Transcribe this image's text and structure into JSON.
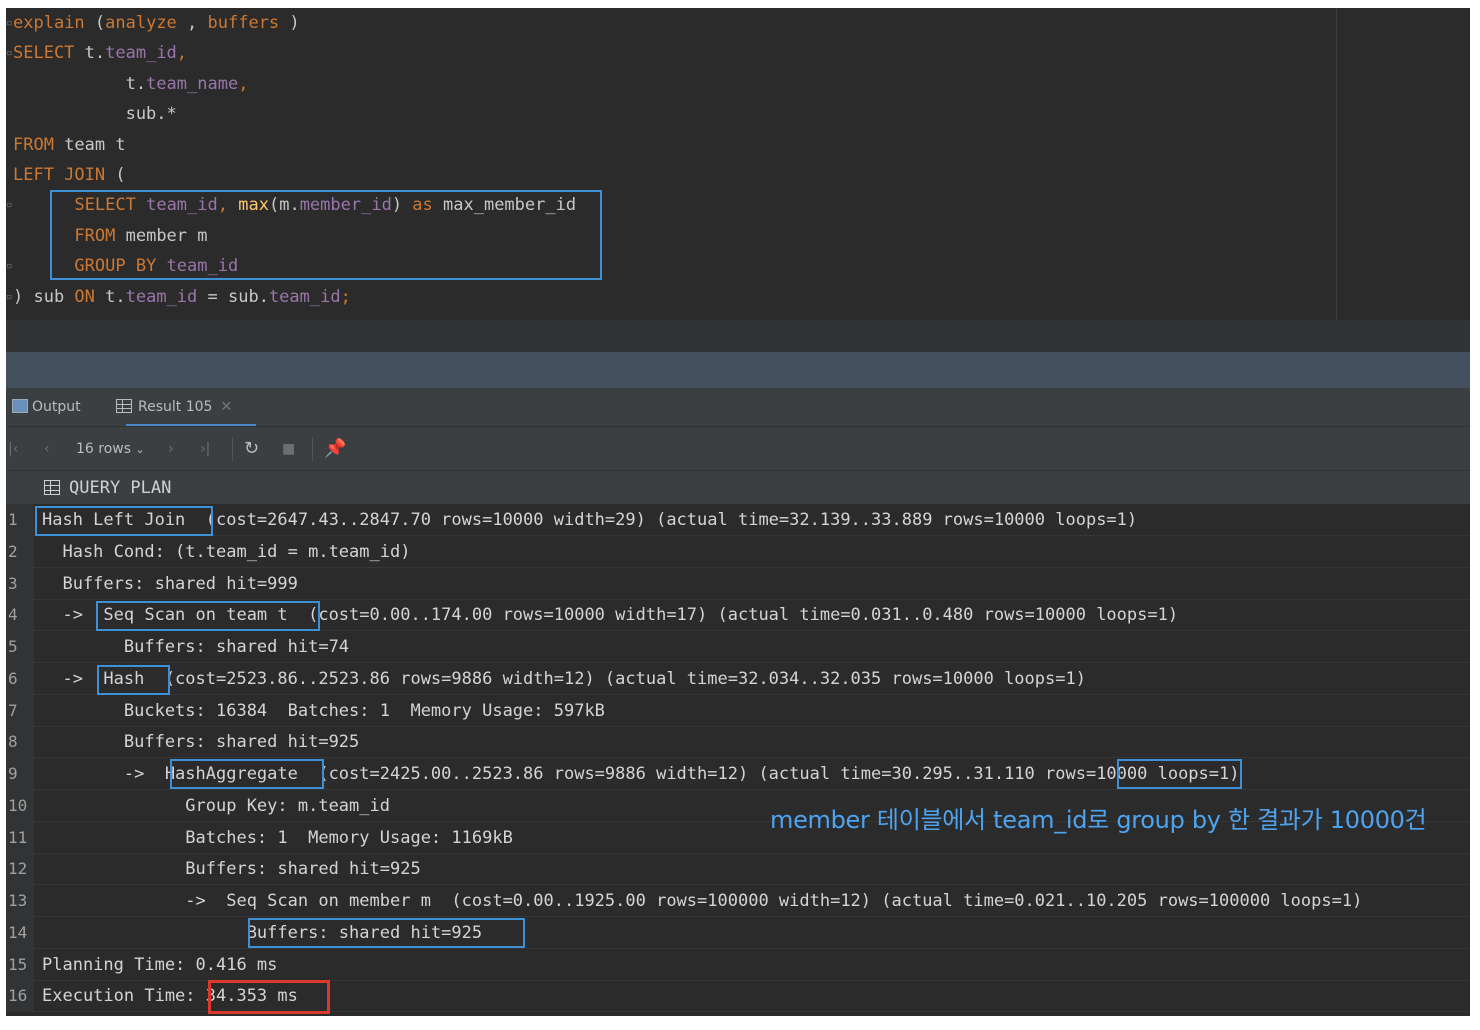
{
  "editor": {
    "lines": [
      {
        "parts": [
          [
            "kw",
            "explain"
          ],
          [
            "pl",
            " ("
          ],
          [
            "kw",
            "analyze"
          ],
          [
            "pl",
            " , "
          ],
          [
            "kw",
            "buffers"
          ],
          [
            "pl",
            " )"
          ]
        ]
      },
      {
        "parts": [
          [
            "kw",
            "SELECT"
          ],
          [
            "pl",
            " t."
          ],
          [
            "id",
            "team_id"
          ],
          [
            "kw",
            ","
          ]
        ]
      },
      {
        "parts": [
          [
            "pl",
            "           t."
          ],
          [
            "id",
            "team_name"
          ],
          [
            "kw",
            ","
          ]
        ]
      },
      {
        "parts": [
          [
            "pl",
            "           sub.*"
          ]
        ]
      },
      {
        "parts": [
          [
            "kw",
            "FROM"
          ],
          [
            "pl",
            " team t"
          ]
        ]
      },
      {
        "parts": [
          [
            "kw",
            "LEFT JOIN"
          ],
          [
            "pl",
            " ("
          ]
        ]
      },
      {
        "parts": [
          [
            "pl",
            "      "
          ],
          [
            "kw",
            "SELECT"
          ],
          [
            "pl",
            " "
          ],
          [
            "id",
            "team_id"
          ],
          [
            "kw",
            ","
          ],
          [
            "pl",
            " "
          ],
          [
            "fn",
            "max"
          ],
          [
            "pl",
            "(m."
          ],
          [
            "id",
            "member_id"
          ],
          [
            "pl",
            ") "
          ],
          [
            "kw",
            "as"
          ],
          [
            "pl",
            " max_member_id"
          ]
        ]
      },
      {
        "parts": [
          [
            "pl",
            "      "
          ],
          [
            "kw",
            "FROM"
          ],
          [
            "pl",
            " member m"
          ]
        ]
      },
      {
        "parts": [
          [
            "pl",
            "      "
          ],
          [
            "kw",
            "GROUP BY"
          ],
          [
            "pl",
            " "
          ],
          [
            "id",
            "team_id"
          ]
        ]
      },
      {
        "parts": [
          [
            "pl",
            ") sub "
          ],
          [
            "kw",
            "ON"
          ],
          [
            "pl",
            " t."
          ],
          [
            "id",
            "team_id"
          ],
          [
            "pl",
            " = sub."
          ],
          [
            "id",
            "team_id"
          ],
          [
            "kw",
            ";"
          ]
        ]
      }
    ]
  },
  "tabs": {
    "output_label": "Output",
    "result_label": "Result 105"
  },
  "toolbar": {
    "rows_label": "16 rows",
    "first_icon": "first-page-icon",
    "prev_icon": "prev-page-icon",
    "next_icon": "next-page-icon",
    "last_icon": "last-page-icon",
    "refresh_icon": "refresh-icon",
    "stop_icon": "stop-icon",
    "pin_icon": "pin-icon"
  },
  "grid": {
    "column_header": "QUERY PLAN",
    "rows": [
      {
        "num": "1",
        "text": "Hash Left Join  (cost=2647.43..2847.70 rows=10000 width=29) (actual time=32.139..33.889 rows=10000 loops=1)"
      },
      {
        "num": "2",
        "text": "  Hash Cond: (t.team_id = m.team_id)"
      },
      {
        "num": "3",
        "text": "  Buffers: shared hit=999"
      },
      {
        "num": "4",
        "text": "  ->  Seq Scan on team t  (cost=0.00..174.00 rows=10000 width=17) (actual time=0.031..0.480 rows=10000 loops=1)"
      },
      {
        "num": "5",
        "text": "        Buffers: shared hit=74"
      },
      {
        "num": "6",
        "text": "  ->  Hash  (cost=2523.86..2523.86 rows=9886 width=12) (actual time=32.034..32.035 rows=10000 loops=1)"
      },
      {
        "num": "7",
        "text": "        Buckets: 16384  Batches: 1  Memory Usage: 597kB"
      },
      {
        "num": "8",
        "text": "        Buffers: shared hit=925"
      },
      {
        "num": "9",
        "text": "        ->  HashAggregate  (cost=2425.00..2523.86 rows=9886 width=12) (actual time=30.295..31.110 rows=10000 loops=1)"
      },
      {
        "num": "10",
        "text": "              Group Key: m.team_id"
      },
      {
        "num": "11",
        "text": "              Batches: 1  Memory Usage: 1169kB"
      },
      {
        "num": "12",
        "text": "              Buffers: shared hit=925"
      },
      {
        "num": "13",
        "text": "              ->  Seq Scan on member m  (cost=0.00..1925.00 rows=100000 width=12) (actual time=0.021..10.205 rows=100000 loops=1)"
      },
      {
        "num": "14",
        "text": "                    Buffers: shared hit=925"
      },
      {
        "num": "15",
        "text": "Planning Time: 0.416 ms"
      },
      {
        "num": "16",
        "text": "Execution Time: 34.353 ms"
      }
    ]
  },
  "annotation": "member 테이블에서 team_id로 group by 한 결과가 10000건",
  "colors": {
    "highlight_blue": "#3d8fd6",
    "highlight_red": "#d93a2b",
    "annotation": "#4ea3f0"
  }
}
